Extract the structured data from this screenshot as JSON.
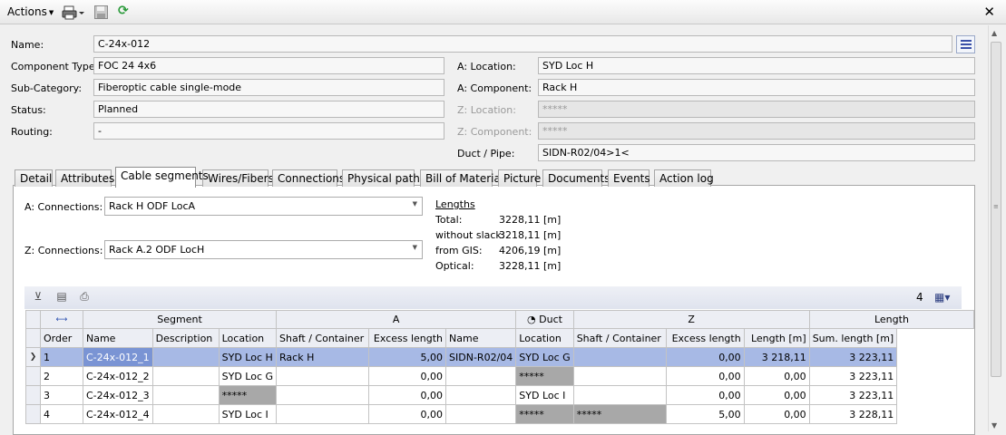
{
  "toolbar": {
    "actions_label": "Actions"
  },
  "form": {
    "name_label": "Name:",
    "name_value": "C-24x-012",
    "component_type_label": "Component Type:",
    "component_type_value": "FOC 24 4x6",
    "sub_category_label": "Sub-Category:",
    "sub_category_value": "Fiberoptic cable single-mode",
    "status_label": "Status:",
    "status_value": "Planned",
    "routing_label": "Routing:",
    "routing_value": "-",
    "a_location_label": "A: Location:",
    "a_location_value": "SYD Loc H",
    "a_component_label": "A: Component:",
    "a_component_value": "Rack H",
    "z_location_label": "Z: Location:",
    "z_location_value": "*****",
    "z_component_label": "Z: Component:",
    "z_component_value": "*****",
    "duct_pipe_label": "Duct / Pipe:",
    "duct_pipe_value": "SIDN-R02/04>1<"
  },
  "tabs": [
    "Detail",
    "Attributes",
    "Cable segments",
    "Wires/Fibers",
    "Connections",
    "Physical paths",
    "Bill of Material",
    "Picture",
    "Documents",
    "Events",
    "Action log"
  ],
  "active_tab": "Cable segments",
  "connections": {
    "a_label": "A: Connections:",
    "a_value": "Rack H ODF LocA",
    "z_label": "Z: Connections:",
    "z_value": "Rack A.2 ODF LocH"
  },
  "lengths": {
    "title": "Lengths",
    "total_label": "Total:",
    "total_value": "3228,11 [m]",
    "without_slack_label": "without slack:",
    "without_slack_value": "3218,11 [m]",
    "from_gis_label": "from GIS:",
    "from_gis_value": "4206,19 [m]",
    "optical_label": "Optical:",
    "optical_value": "3228,11 [m]"
  },
  "grid_toolbar": {
    "count": "4"
  },
  "grid": {
    "groups": {
      "segment": "Segment",
      "a": "A",
      "duct": "Duct",
      "z": "Z",
      "length": "Length"
    },
    "columns": [
      "Order",
      "Name",
      "Description",
      "Location",
      "Shaft / Container",
      "Excess length",
      "Name",
      "Location",
      "Shaft / Container",
      "Excess length",
      "Length [m]",
      "Sum. length [m]"
    ],
    "rows": [
      {
        "order": "1",
        "name": "C-24x-012_1",
        "description": "",
        "a_location": "SYD Loc H",
        "a_shaft": "Rack H",
        "a_excess": "5,00",
        "duct_name": "SIDN-R02/04",
        "z_location": "SYD Loc G",
        "z_shaft": "",
        "z_excess": "0,00",
        "length": "3 218,11",
        "sum_length": "3 223,11"
      },
      {
        "order": "2",
        "name": "C-24x-012_2",
        "description": "",
        "a_location": "SYD Loc G",
        "a_shaft": "",
        "a_excess": "0,00",
        "duct_name": "",
        "z_location": "*****",
        "z_shaft": "",
        "z_excess": "0,00",
        "length": "0,00",
        "sum_length": "3 223,11"
      },
      {
        "order": "3",
        "name": "C-24x-012_3",
        "description": "",
        "a_location": "*****",
        "a_shaft": "",
        "a_excess": "0,00",
        "duct_name": "",
        "z_location": "SYD Loc I",
        "z_shaft": "",
        "z_excess": "0,00",
        "length": "0,00",
        "sum_length": "3 223,11"
      },
      {
        "order": "4",
        "name": "C-24x-012_4",
        "description": "",
        "a_location": "SYD Loc I",
        "a_shaft": "",
        "a_excess": "0,00",
        "duct_name": "",
        "z_location": "*****",
        "z_shaft": "*****",
        "z_excess": "5,00",
        "length": "0,00",
        "sum_length": "3 228,11"
      }
    ]
  }
}
